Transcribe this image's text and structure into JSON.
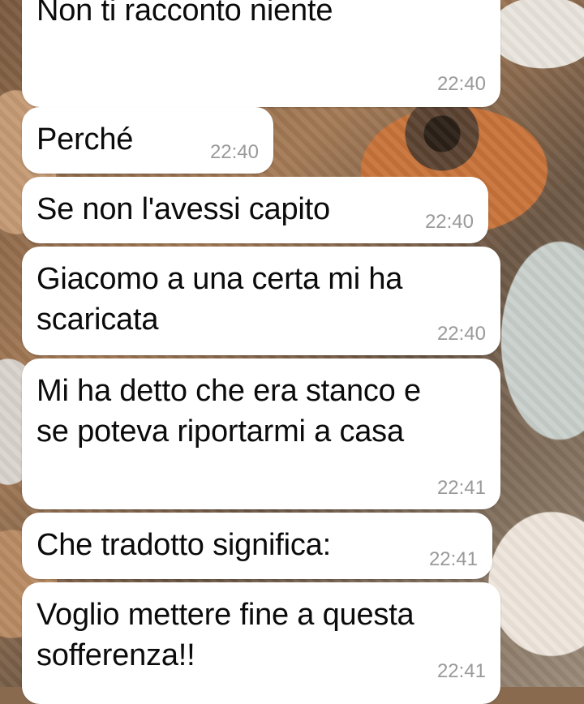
{
  "colors": {
    "bubble_background": "#ffffff",
    "text": "#0b0b0b",
    "timestamp": "#9a9a9a"
  },
  "messages": [
    {
      "text": "Non ti racconto niente",
      "time": "22:40"
    },
    {
      "text": "Perché",
      "time": "22:40"
    },
    {
      "text": "Se non l'avessi capito",
      "time": "22:40"
    },
    {
      "text": "Giacomo a una certa mi ha\nscaricata",
      "time": "22:40"
    },
    {
      "text": "Mi ha detto che era stanco e\nse poteva riportarmi a casa",
      "time": "22:41"
    },
    {
      "text": "Che tradotto significa:",
      "time": "22:41"
    },
    {
      "text": "Voglio mettere fine a questa\nsofferenza!!",
      "time": "22:41"
    }
  ]
}
